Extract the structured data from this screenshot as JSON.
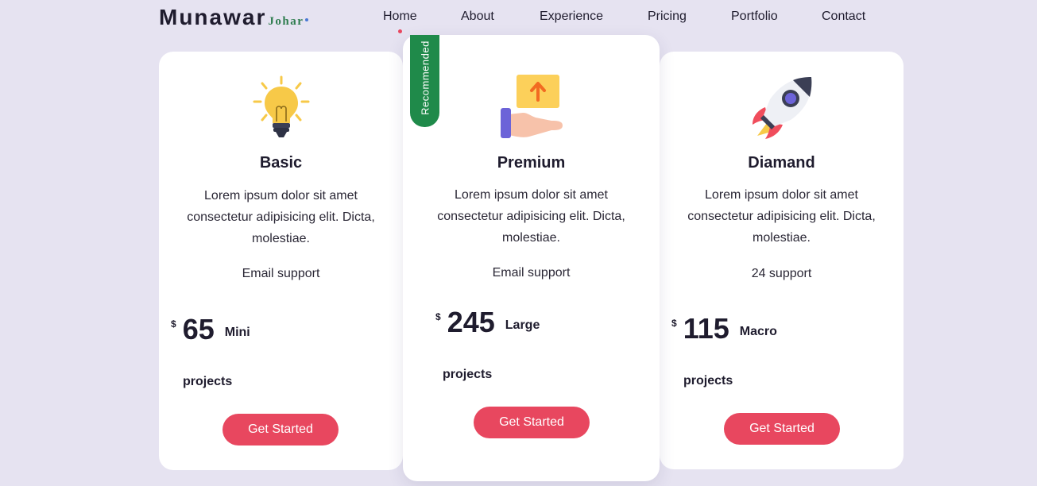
{
  "brand": {
    "name": "Munawar",
    "suffix": "Johar"
  },
  "nav": {
    "items": [
      {
        "label": "Home",
        "active": true
      },
      {
        "label": "About",
        "active": false
      },
      {
        "label": "Experience",
        "active": false
      },
      {
        "label": "Pricing",
        "active": false
      },
      {
        "label": "Portfolio",
        "active": false
      },
      {
        "label": "Contact",
        "active": false
      }
    ]
  },
  "colors": {
    "background": "#e6e3f1",
    "accent": "#e8475f",
    "ribbon": "#1f8a4a",
    "text": "#1f1c2e"
  },
  "plans": [
    {
      "icon": "lightbulb-icon",
      "title": "Basic",
      "description": "Lorem ipsum dolor sit amet consectetur adipisicing elit. Dicta, molestiae.",
      "support": "Email support",
      "currency": "$",
      "price": "65",
      "size": "Mini",
      "unit": "projects",
      "cta": "Get Started"
    },
    {
      "icon": "hand-upload-box-icon",
      "badge": "Recommended",
      "title": "Premium",
      "description": "Lorem ipsum dolor sit amet consectetur adipisicing elit. Dicta, molestiae.",
      "support": "Email support",
      "currency": "$",
      "price": "245",
      "size": "Large",
      "unit": "projects",
      "cta": "Get Started"
    },
    {
      "icon": "rocket-icon",
      "title": "Diamand",
      "description": "Lorem ipsum dolor sit amet consectetur adipisicing elit. Dicta, molestiae.",
      "support": "24 support",
      "currency": "$",
      "price": "115",
      "size": "Macro",
      "unit": "projects",
      "cta": "Get Started"
    }
  ]
}
